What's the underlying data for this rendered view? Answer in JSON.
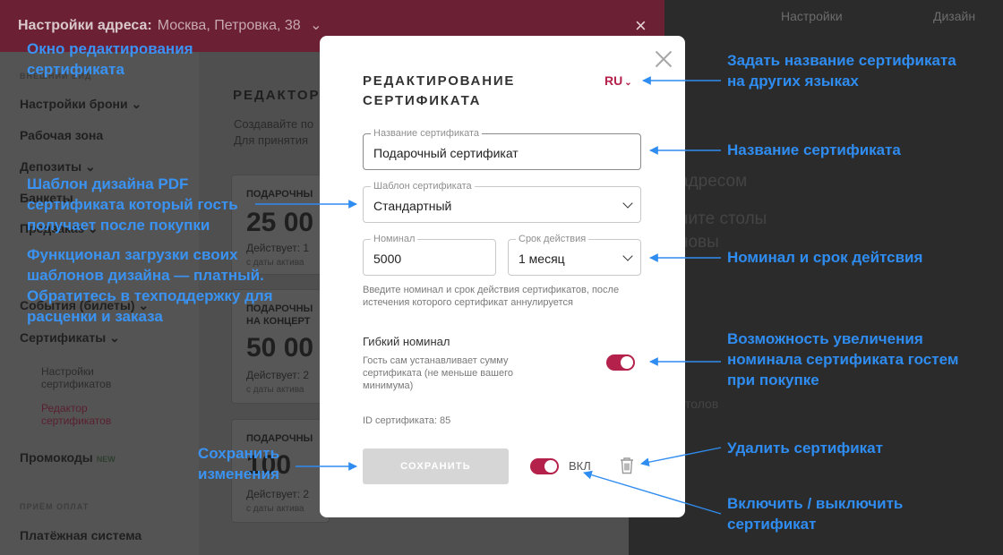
{
  "background": {
    "header_label": "Настройки адреса:",
    "header_address": "Москва, Петровка, 38",
    "header_chevron": "⌄",
    "header_close": "×",
    "top_right": [
      "Настройки",
      "Дизайн"
    ],
    "sidebar": {
      "caption1": "ВНЕШНИЙ ВИД",
      "items": [
        "Настройки брони ⌄",
        "Рабочая зона",
        "Депозиты ⌄",
        "Банкеты",
        "Предзаказ ⌄",
        "События (билеты) ⌄",
        "Сертификаты ⌄"
      ],
      "sub_items": [
        "Настройки сертификатов",
        "Редактор сертификатов"
      ],
      "promo": "Промокоды",
      "new_badge": "NEW",
      "caption2": "ПРИЁМ ОПЛАТ",
      "payment": "Платёжная система"
    },
    "main": {
      "title": "РЕДАКТОР",
      "desc_line1": "Создавайте по",
      "desc_line2": "Для принятия"
    },
    "cards": [
      {
        "title": "ПОДАРОЧНЫ",
        "value": "25 00",
        "status": "Действует: 1",
        "sub": "с даты актива"
      },
      {
        "title": "ПОДАРОЧНЫ НА КОНЦЕРТ",
        "value": "50 00",
        "status": "Действует: 2",
        "sub": "с даты актива"
      },
      {
        "title": "ПОДАРОЧНЫ",
        "value": "100",
        "status": "Действует: 2",
        "sub": "с даты актива"
      }
    ],
    "right_texts": [
      "адресом",
      "ните столы",
      "новы",
      "столов"
    ]
  },
  "modal": {
    "title": "РЕДАКТИРОВАНИЕ СЕРТИФИКАТА",
    "language": "RU",
    "name_field": {
      "label": "Название сертификата",
      "value": "Подарочный сертификат"
    },
    "template_field": {
      "label": "Шаблон сертификата",
      "value": "Стандартный"
    },
    "nominal_field": {
      "label": "Номинал",
      "value": "5000"
    },
    "validity_field": {
      "label": "Срок действия",
      "value": "1 месяц"
    },
    "hint": "Введите номинал и срок действия сертификатов, после истечения которого сертификат аннулируется",
    "flexible": {
      "title": "Гибкий номинал",
      "desc": "Гость сам устанавливает сумму сертификата (не меньше вашего минимума)",
      "enabled": true
    },
    "certificate_id": "ID сертификата: 85",
    "save_label": "СОХРАНИТЬ",
    "enabled_label": "ВКЛ",
    "enabled": true
  },
  "annotations": {
    "window": "Окно редактирования сертификата",
    "template": "Шаблон дизайна PDF сертификата который гость получает после покупки",
    "paid": "Функционал загрузки своих шаблонов дизайна — платный. Обратитесь в техподдержку для расценки и заказа",
    "save": "Сохранить изменения",
    "language": "Задать название сертификата на других языках",
    "name": "Название сертификата",
    "nominal": "Номинал и срок дейтсвия",
    "flexible": "Возможность увеличения номинала сертификата гостем при покупке",
    "delete": "Удалить сертификат",
    "toggle": "Включить / выключить сертификат"
  },
  "colors": {
    "accent": "#b4214b",
    "annotation": "#2f8cf0",
    "header_bg": "#6b2033"
  }
}
